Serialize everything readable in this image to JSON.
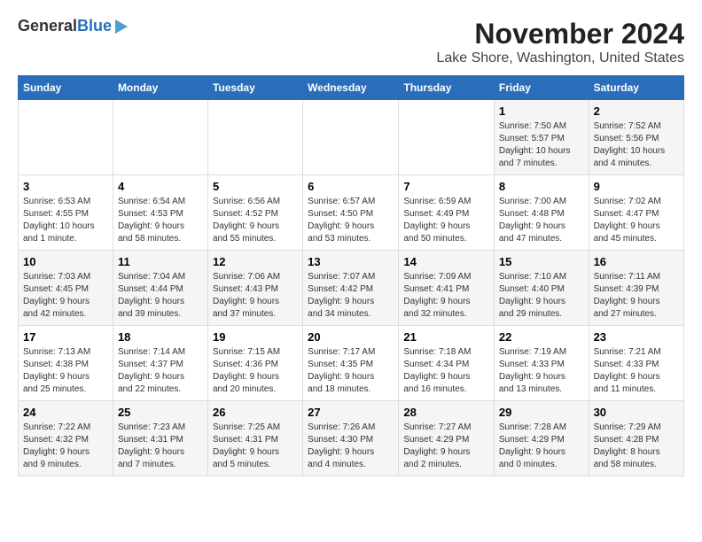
{
  "logo": {
    "general": "General",
    "blue": "Blue"
  },
  "title": "November 2024",
  "location": "Lake Shore, Washington, United States",
  "weekdays": [
    "Sunday",
    "Monday",
    "Tuesday",
    "Wednesday",
    "Thursday",
    "Friday",
    "Saturday"
  ],
  "weeks": [
    [
      {
        "day": "",
        "info": ""
      },
      {
        "day": "",
        "info": ""
      },
      {
        "day": "",
        "info": ""
      },
      {
        "day": "",
        "info": ""
      },
      {
        "day": "",
        "info": ""
      },
      {
        "day": "1",
        "info": "Sunrise: 7:50 AM\nSunset: 5:57 PM\nDaylight: 10 hours\nand 7 minutes."
      },
      {
        "day": "2",
        "info": "Sunrise: 7:52 AM\nSunset: 5:56 PM\nDaylight: 10 hours\nand 4 minutes."
      }
    ],
    [
      {
        "day": "3",
        "info": "Sunrise: 6:53 AM\nSunset: 4:55 PM\nDaylight: 10 hours\nand 1 minute."
      },
      {
        "day": "4",
        "info": "Sunrise: 6:54 AM\nSunset: 4:53 PM\nDaylight: 9 hours\nand 58 minutes."
      },
      {
        "day": "5",
        "info": "Sunrise: 6:56 AM\nSunset: 4:52 PM\nDaylight: 9 hours\nand 55 minutes."
      },
      {
        "day": "6",
        "info": "Sunrise: 6:57 AM\nSunset: 4:50 PM\nDaylight: 9 hours\nand 53 minutes."
      },
      {
        "day": "7",
        "info": "Sunrise: 6:59 AM\nSunset: 4:49 PM\nDaylight: 9 hours\nand 50 minutes."
      },
      {
        "day": "8",
        "info": "Sunrise: 7:00 AM\nSunset: 4:48 PM\nDaylight: 9 hours\nand 47 minutes."
      },
      {
        "day": "9",
        "info": "Sunrise: 7:02 AM\nSunset: 4:47 PM\nDaylight: 9 hours\nand 45 minutes."
      }
    ],
    [
      {
        "day": "10",
        "info": "Sunrise: 7:03 AM\nSunset: 4:45 PM\nDaylight: 9 hours\nand 42 minutes."
      },
      {
        "day": "11",
        "info": "Sunrise: 7:04 AM\nSunset: 4:44 PM\nDaylight: 9 hours\nand 39 minutes."
      },
      {
        "day": "12",
        "info": "Sunrise: 7:06 AM\nSunset: 4:43 PM\nDaylight: 9 hours\nand 37 minutes."
      },
      {
        "day": "13",
        "info": "Sunrise: 7:07 AM\nSunset: 4:42 PM\nDaylight: 9 hours\nand 34 minutes."
      },
      {
        "day": "14",
        "info": "Sunrise: 7:09 AM\nSunset: 4:41 PM\nDaylight: 9 hours\nand 32 minutes."
      },
      {
        "day": "15",
        "info": "Sunrise: 7:10 AM\nSunset: 4:40 PM\nDaylight: 9 hours\nand 29 minutes."
      },
      {
        "day": "16",
        "info": "Sunrise: 7:11 AM\nSunset: 4:39 PM\nDaylight: 9 hours\nand 27 minutes."
      }
    ],
    [
      {
        "day": "17",
        "info": "Sunrise: 7:13 AM\nSunset: 4:38 PM\nDaylight: 9 hours\nand 25 minutes."
      },
      {
        "day": "18",
        "info": "Sunrise: 7:14 AM\nSunset: 4:37 PM\nDaylight: 9 hours\nand 22 minutes."
      },
      {
        "day": "19",
        "info": "Sunrise: 7:15 AM\nSunset: 4:36 PM\nDaylight: 9 hours\nand 20 minutes."
      },
      {
        "day": "20",
        "info": "Sunrise: 7:17 AM\nSunset: 4:35 PM\nDaylight: 9 hours\nand 18 minutes."
      },
      {
        "day": "21",
        "info": "Sunrise: 7:18 AM\nSunset: 4:34 PM\nDaylight: 9 hours\nand 16 minutes."
      },
      {
        "day": "22",
        "info": "Sunrise: 7:19 AM\nSunset: 4:33 PM\nDaylight: 9 hours\nand 13 minutes."
      },
      {
        "day": "23",
        "info": "Sunrise: 7:21 AM\nSunset: 4:33 PM\nDaylight: 9 hours\nand 11 minutes."
      }
    ],
    [
      {
        "day": "24",
        "info": "Sunrise: 7:22 AM\nSunset: 4:32 PM\nDaylight: 9 hours\nand 9 minutes."
      },
      {
        "day": "25",
        "info": "Sunrise: 7:23 AM\nSunset: 4:31 PM\nDaylight: 9 hours\nand 7 minutes."
      },
      {
        "day": "26",
        "info": "Sunrise: 7:25 AM\nSunset: 4:31 PM\nDaylight: 9 hours\nand 5 minutes."
      },
      {
        "day": "27",
        "info": "Sunrise: 7:26 AM\nSunset: 4:30 PM\nDaylight: 9 hours\nand 4 minutes."
      },
      {
        "day": "28",
        "info": "Sunrise: 7:27 AM\nSunset: 4:29 PM\nDaylight: 9 hours\nand 2 minutes."
      },
      {
        "day": "29",
        "info": "Sunrise: 7:28 AM\nSunset: 4:29 PM\nDaylight: 9 hours\nand 0 minutes."
      },
      {
        "day": "30",
        "info": "Sunrise: 7:29 AM\nSunset: 4:28 PM\nDaylight: 8 hours\nand 58 minutes."
      }
    ]
  ]
}
